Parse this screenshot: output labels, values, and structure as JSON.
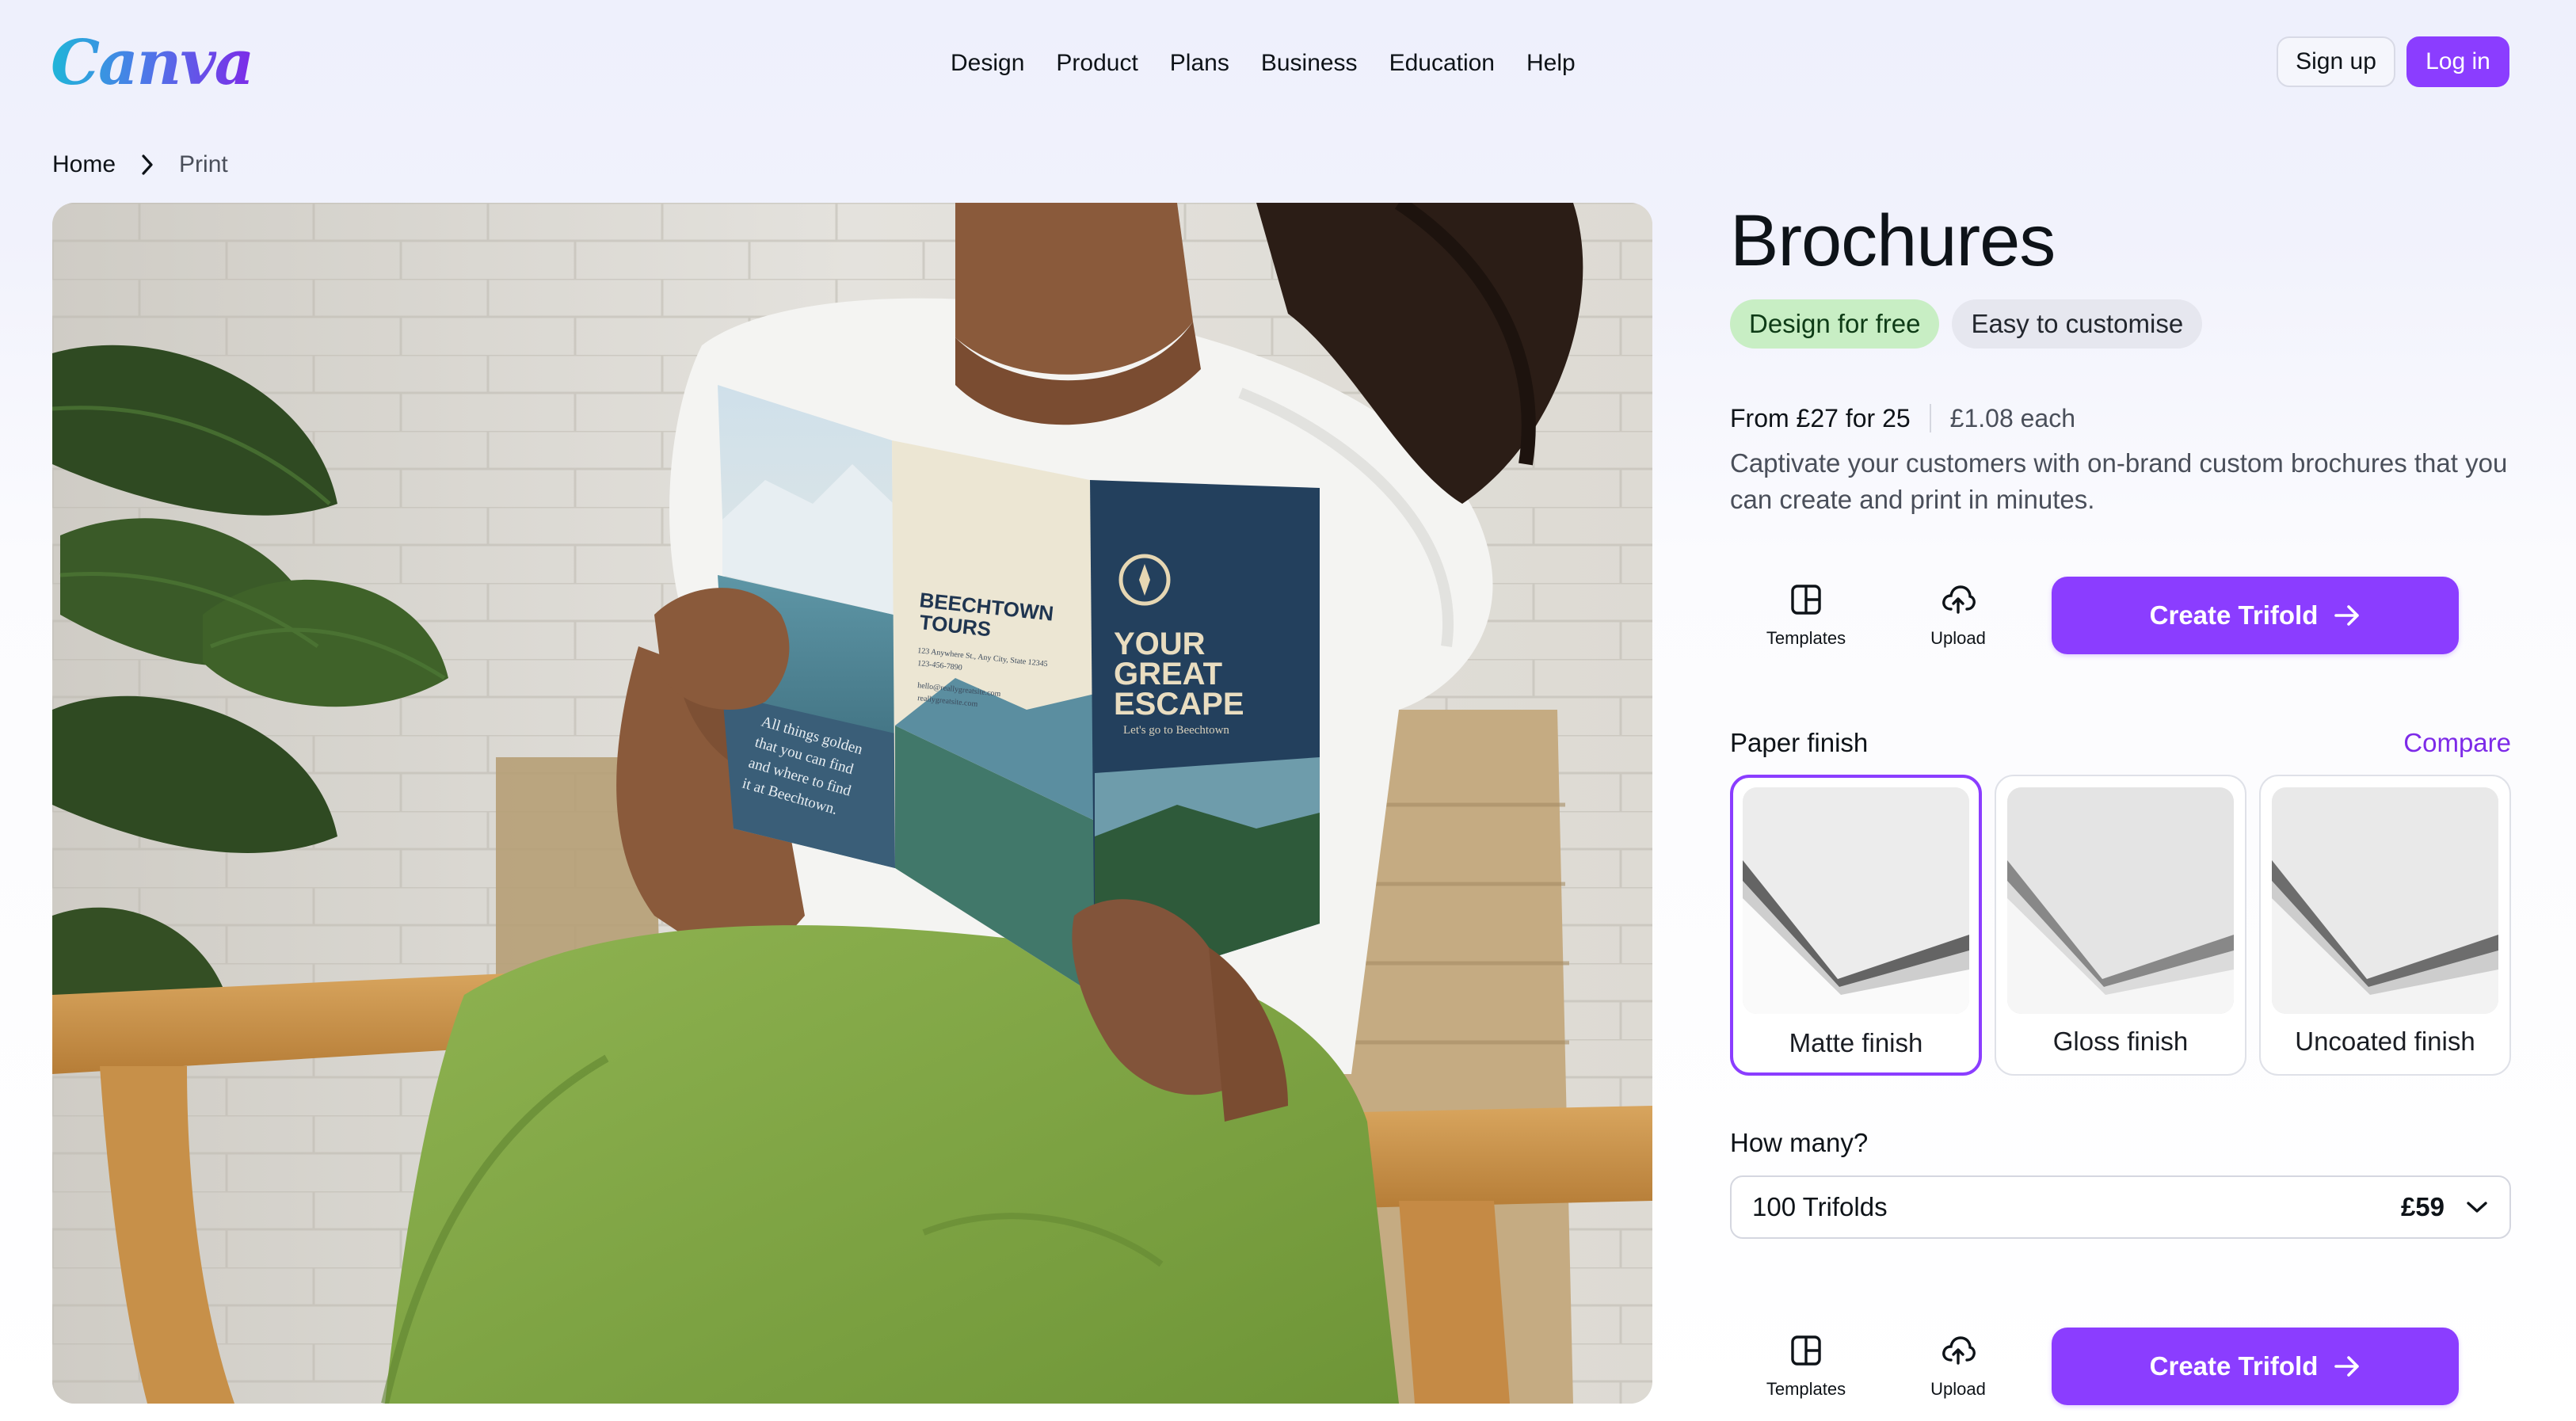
{
  "brand": {
    "logo_text": "Canva",
    "accent": "#8b3dff",
    "accent_text": "#7d2ae8"
  },
  "nav": {
    "items": [
      "Design",
      "Product",
      "Plans",
      "Business",
      "Education",
      "Help"
    ],
    "signup_label": "Sign up",
    "login_label": "Log in"
  },
  "breadcrumb": {
    "home": "Home",
    "current": "Print",
    "separator_icon": "chevron-right-icon"
  },
  "hero": {
    "alt": "Woman seated in a wooden chair reading a trifold brochure",
    "brochure": {
      "inner_heading_1": "BEECHTOWN",
      "inner_heading_2": "TOURS",
      "inner_details": [
        "123 Anywhere St., Any City, State 12345",
        "123-456-7890",
        "hello@reallygreatsite.com",
        "reallygreatsite.com"
      ],
      "cover_line_1": "YOUR",
      "cover_line_2": "GREAT",
      "cover_line_3": "ESCAPE",
      "cover_sub": "Let's go to Beechtown",
      "flap_line_1": "All things golden",
      "flap_line_2": "that you can find",
      "flap_line_3": "and where to find",
      "flap_line_4": "it at Beechtown."
    }
  },
  "product": {
    "title": "Brochures",
    "badges": [
      "Design for free",
      "Easy to customise"
    ],
    "price_from": "From £27 for 25",
    "price_each": "£1.08 each",
    "description": "Captivate your customers with on-brand custom brochures that you can create and print in minutes.",
    "tools": {
      "templates": "Templates",
      "upload": "Upload"
    },
    "create_label": "Create Trifold",
    "paper_finish_label": "Paper finish",
    "compare_label": "Compare",
    "finishes": [
      {
        "name": "Matte finish",
        "selected": true
      },
      {
        "name": "Gloss finish",
        "selected": false
      },
      {
        "name": "Uncoated finish",
        "selected": false
      }
    ],
    "quantity_label": "How many?",
    "quantity_value": "100 Trifolds",
    "quantity_price": "£59"
  }
}
